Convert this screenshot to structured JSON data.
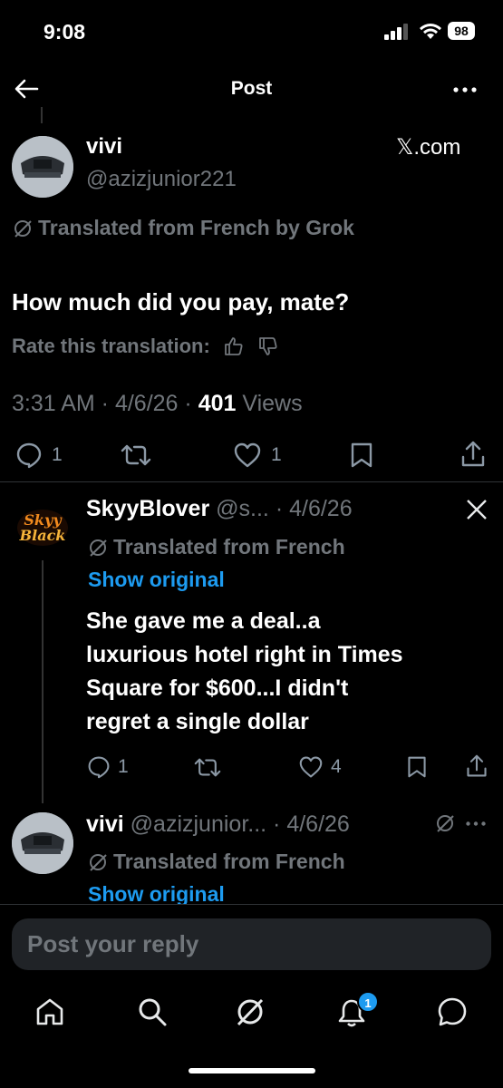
{
  "status_bar": {
    "time": "9:08",
    "battery": "98"
  },
  "nav": {
    "title": "Post"
  },
  "main_post": {
    "display_name": "vivi",
    "handle": "@azizjunior221",
    "source": "𝕏.com",
    "translated_note": "Translated from French by Grok",
    "text": "How much did you pay, mate?",
    "rate_label": "Rate this translation:",
    "time": "3:31 AM",
    "date": "4/6/26",
    "views_count": "401",
    "views_label": "Views",
    "replies": "1",
    "likes": "1"
  },
  "reply_1": {
    "display_name": "SkyyBlover",
    "handle": "@s...",
    "date": "4/6/26",
    "avatar_text_top": "Skyy",
    "avatar_text_bottom": "Black",
    "translated_note": "Translated from French",
    "show_original": "Show original",
    "text_lines": [
      "She gave me a deal..a",
      "luxurious hotel right in Times",
      "Square for $600...I didn't",
      "regret a single dollar"
    ],
    "replies": "1",
    "likes": "4"
  },
  "reply_2": {
    "display_name": "vivi",
    "handle": "@azizjunior...",
    "date": "4/6/26",
    "translated_note": "Translated from French",
    "show_original": "Show original"
  },
  "composer": {
    "placeholder": "Post your reply"
  },
  "tab_bar": {
    "notifications_badge": "1"
  },
  "colors": {
    "background": "#000000",
    "text": "#e7e9ea",
    "muted": "#71767b",
    "accent": "#1d9bf0",
    "divider": "#2f3336"
  }
}
